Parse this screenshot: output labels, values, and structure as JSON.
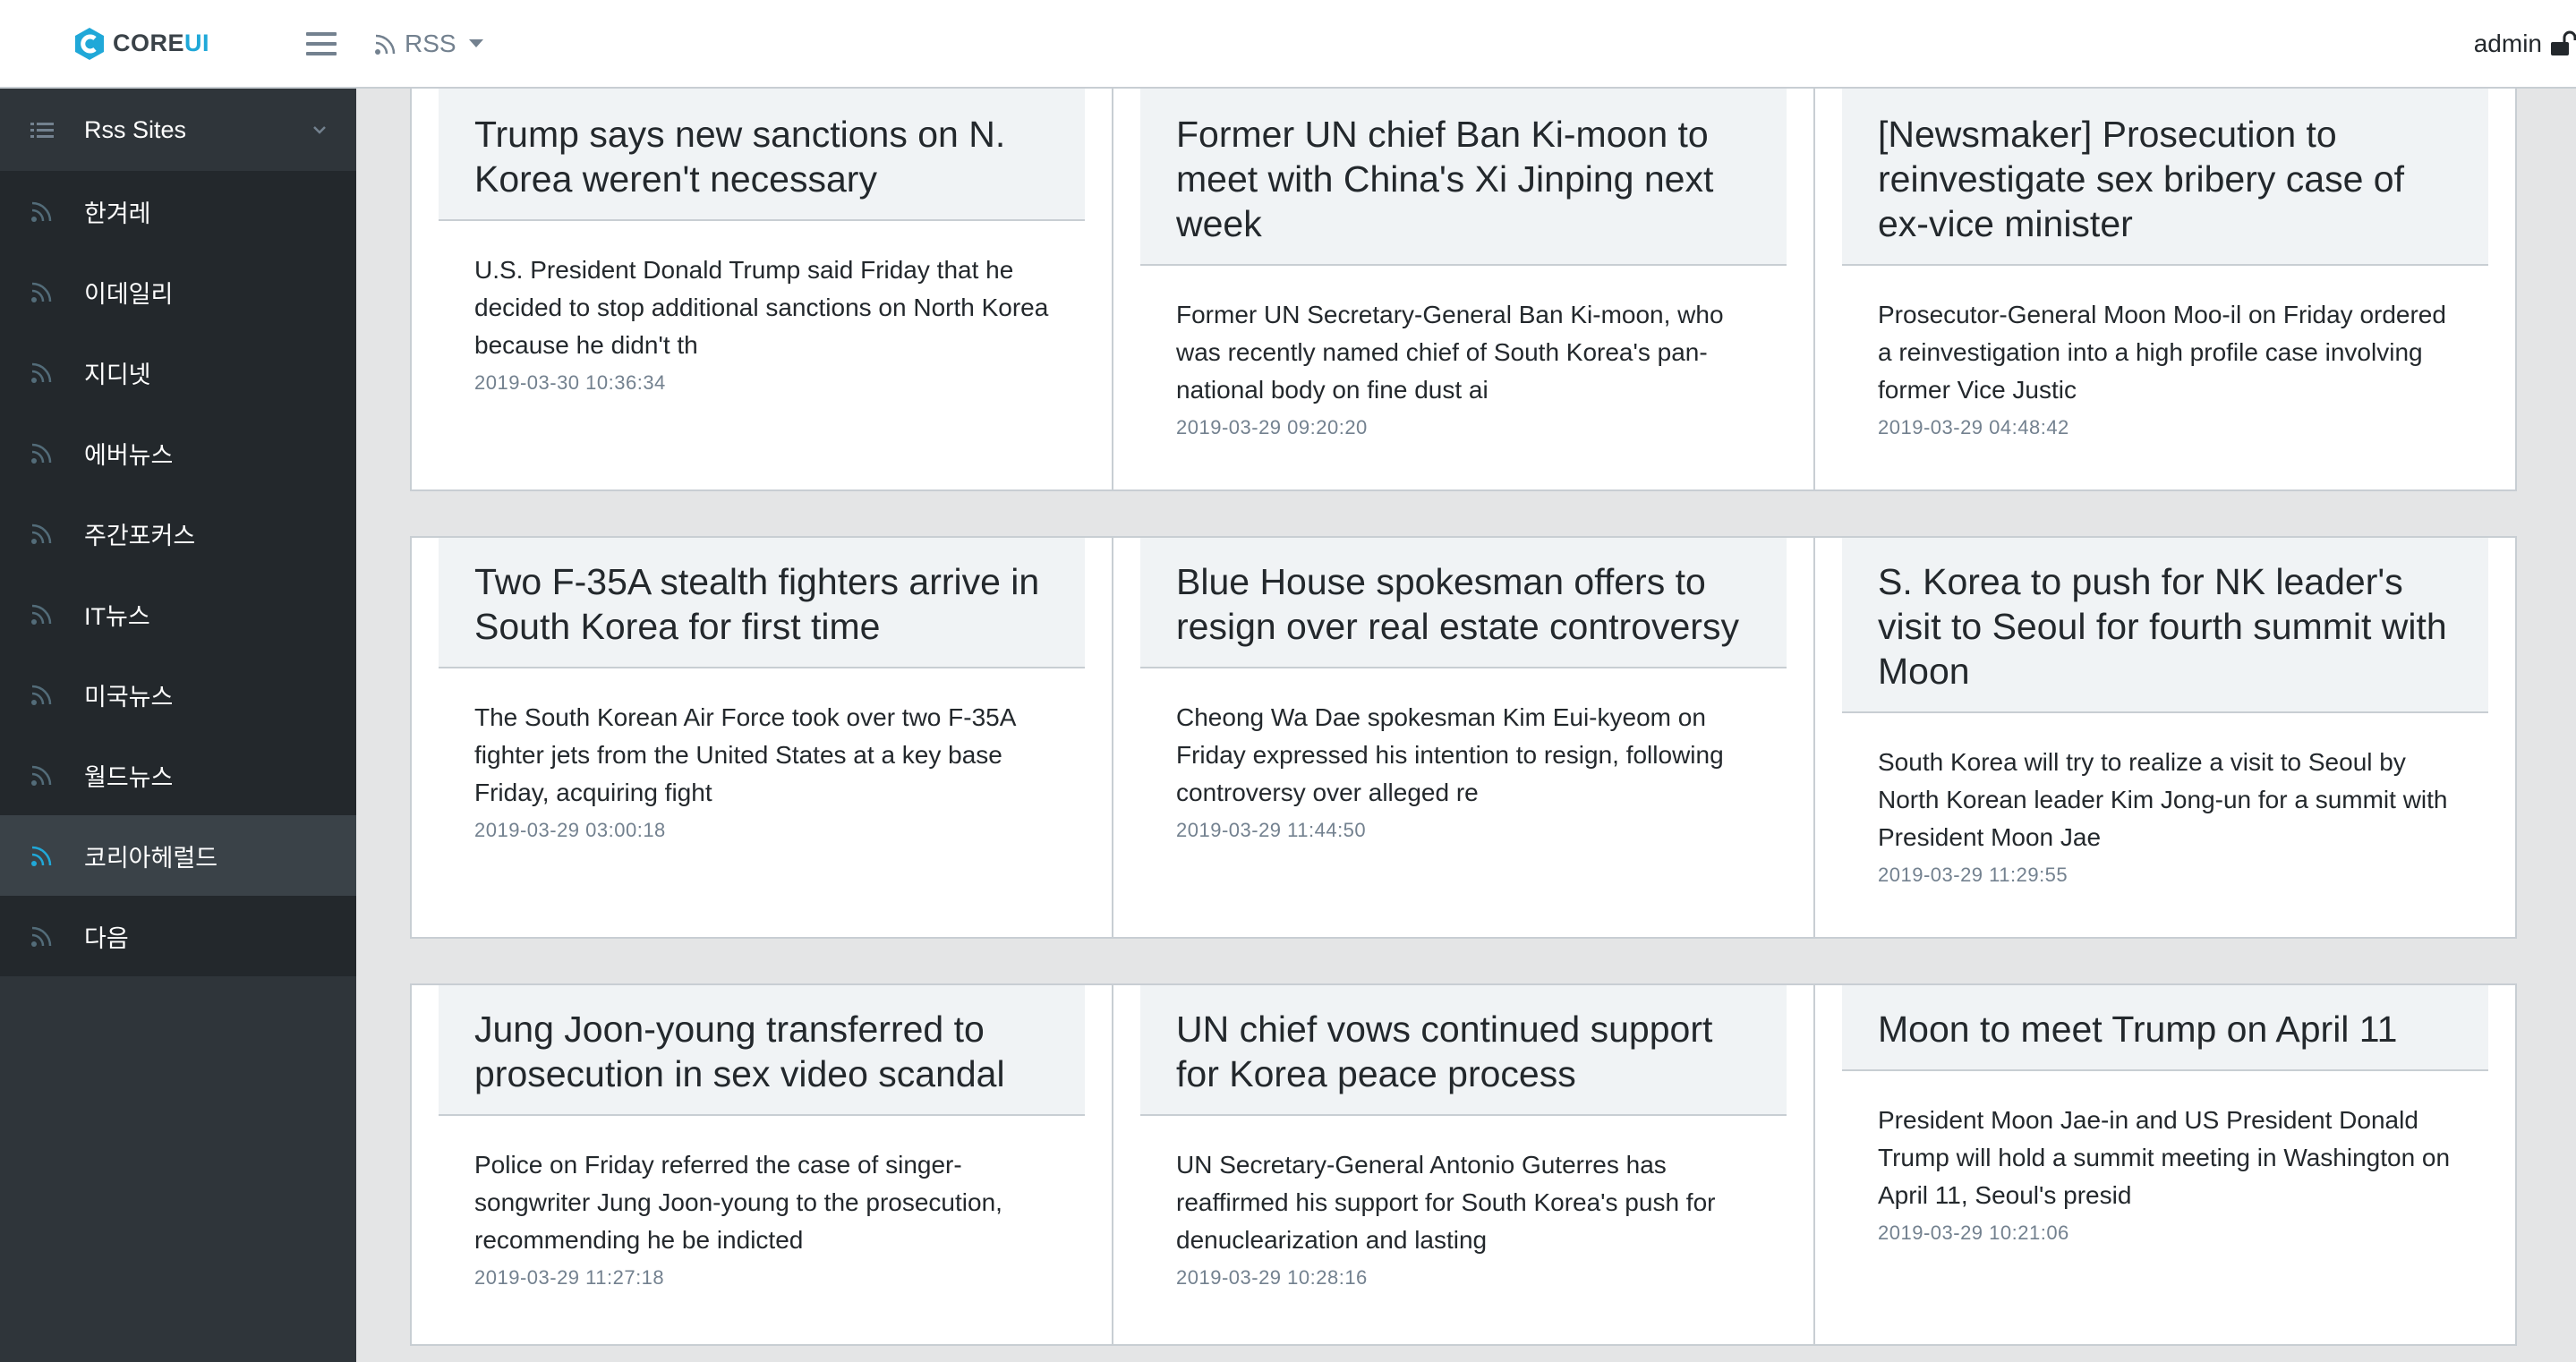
{
  "header": {
    "brand_core": "CORE",
    "brand_ui": "UI",
    "menu_label": "RSS",
    "user": "admin"
  },
  "sidebar": {
    "dropdown_label": "Rss Sites",
    "items": [
      {
        "label": "한겨레"
      },
      {
        "label": "이데일리"
      },
      {
        "label": "지디넷"
      },
      {
        "label": "에버뉴스"
      },
      {
        "label": "주간포커스"
      },
      {
        "label": "IT뉴스"
      },
      {
        "label": "미국뉴스"
      },
      {
        "label": "월드뉴스"
      },
      {
        "label": "코리아헤럴드",
        "active": true
      },
      {
        "label": "다음"
      }
    ]
  },
  "articles": [
    {
      "title": "Trump says new sanctions on N. Korea weren't necessary",
      "summary": "U.S. President Donald Trump said Friday that he decided to stop additional sanctions on North Korea because he didn't th",
      "date": "2019-03-30 10:36:34"
    },
    {
      "title": "Former UN chief Ban Ki-moon to meet with China's Xi Jinping next week",
      "summary": "Former UN Secretary-General Ban Ki-moon, who was recently named chief of South Korea's pan-national body on fine dust ai",
      "date": "2019-03-29 09:20:20"
    },
    {
      "title": "[Newsmaker] Prosecution to reinvestigate sex bribery case of ex-vice minister",
      "summary": "Prosecutor-General Moon Moo-il on Friday ordered a reinvestigation into a high profile case involving former Vice Justic",
      "date": "2019-03-29 04:48:42"
    },
    {
      "title": "Two F-35A stealth fighters arrive in South Korea for first time",
      "summary": "The South Korean Air Force took over two F-35A fighter jets from the United States at a key base Friday, acquiring fight",
      "date": "2019-03-29 03:00:18"
    },
    {
      "title": "Blue House spokesman offers to resign over real estate controversy",
      "summary": "Cheong Wa Dae spokesman Kim Eui-kyeom on Friday expressed his intention to resign, following controversy over alleged re",
      "date": "2019-03-29 11:44:50"
    },
    {
      "title": "S. Korea to push for NK leader's visit to Seoul for fourth summit with Moon",
      "summary": "South Korea will try to realize a visit to Seoul by North Korean leader Kim Jong-un for a summit with President Moon Jae",
      "date": "2019-03-29 11:29:55"
    },
    {
      "title": "Jung Joon-young transferred to prosecution in sex video scandal",
      "summary": "Police on Friday referred the case of singer-songwriter Jung Joon-young to the prosecution, recommending he be indicted",
      "date": "2019-03-29 11:27:18"
    },
    {
      "title": "UN chief vows continued support for Korea peace process",
      "summary": "UN Secretary-General Antonio Guterres has reaffirmed his support for South Korea's push for denuclearization and lasting",
      "date": "2019-03-29 10:28:16"
    },
    {
      "title": "Moon to meet Trump on April 11",
      "summary": "President Moon Jae-in and US President Donald Trump will hold a summit meeting in Washington on April 11, Seoul's presid",
      "date": "2019-03-29 10:21:06"
    }
  ],
  "colors": {
    "brand_accent": "#20a8d8",
    "sidebar_bg": "#2f353a",
    "sidebar_list_bg": "#23282c",
    "sidebar_active_bg": "#3a4248",
    "muted": "#73818f"
  },
  "icons": {
    "brand": "coreui-logo-icon",
    "menu": "hamburger-icon",
    "rss": "rss-icon",
    "list": "list-icon",
    "chevron": "chevron-down-icon",
    "lock": "lock-open-icon"
  }
}
